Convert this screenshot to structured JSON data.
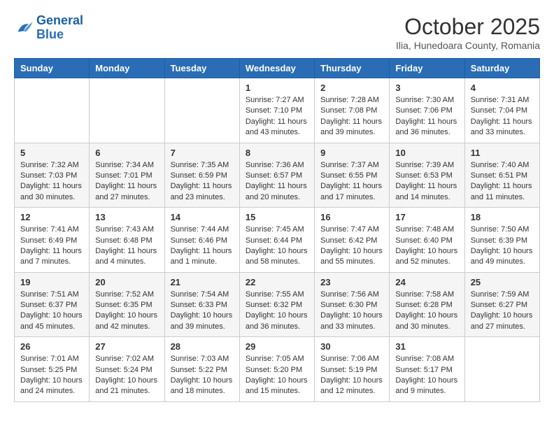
{
  "header": {
    "logo_general": "General",
    "logo_blue": "Blue",
    "month": "October 2025",
    "location": "Ilia, Hunedoara County, Romania"
  },
  "days_of_week": [
    "Sunday",
    "Monday",
    "Tuesday",
    "Wednesday",
    "Thursday",
    "Friday",
    "Saturday"
  ],
  "weeks": [
    [
      {
        "day": "",
        "sunrise": "",
        "sunset": "",
        "daylight": ""
      },
      {
        "day": "",
        "sunrise": "",
        "sunset": "",
        "daylight": ""
      },
      {
        "day": "",
        "sunrise": "",
        "sunset": "",
        "daylight": ""
      },
      {
        "day": "1",
        "sunrise": "Sunrise: 7:27 AM",
        "sunset": "Sunset: 7:10 PM",
        "daylight": "Daylight: 11 hours and 43 minutes."
      },
      {
        "day": "2",
        "sunrise": "Sunrise: 7:28 AM",
        "sunset": "Sunset: 7:08 PM",
        "daylight": "Daylight: 11 hours and 39 minutes."
      },
      {
        "day": "3",
        "sunrise": "Sunrise: 7:30 AM",
        "sunset": "Sunset: 7:06 PM",
        "daylight": "Daylight: 11 hours and 36 minutes."
      },
      {
        "day": "4",
        "sunrise": "Sunrise: 7:31 AM",
        "sunset": "Sunset: 7:04 PM",
        "daylight": "Daylight: 11 hours and 33 minutes."
      }
    ],
    [
      {
        "day": "5",
        "sunrise": "Sunrise: 7:32 AM",
        "sunset": "Sunset: 7:03 PM",
        "daylight": "Daylight: 11 hours and 30 minutes."
      },
      {
        "day": "6",
        "sunrise": "Sunrise: 7:34 AM",
        "sunset": "Sunset: 7:01 PM",
        "daylight": "Daylight: 11 hours and 27 minutes."
      },
      {
        "day": "7",
        "sunrise": "Sunrise: 7:35 AM",
        "sunset": "Sunset: 6:59 PM",
        "daylight": "Daylight: 11 hours and 23 minutes."
      },
      {
        "day": "8",
        "sunrise": "Sunrise: 7:36 AM",
        "sunset": "Sunset: 6:57 PM",
        "daylight": "Daylight: 11 hours and 20 minutes."
      },
      {
        "day": "9",
        "sunrise": "Sunrise: 7:37 AM",
        "sunset": "Sunset: 6:55 PM",
        "daylight": "Daylight: 11 hours and 17 minutes."
      },
      {
        "day": "10",
        "sunrise": "Sunrise: 7:39 AM",
        "sunset": "Sunset: 6:53 PM",
        "daylight": "Daylight: 11 hours and 14 minutes."
      },
      {
        "day": "11",
        "sunrise": "Sunrise: 7:40 AM",
        "sunset": "Sunset: 6:51 PM",
        "daylight": "Daylight: 11 hours and 11 minutes."
      }
    ],
    [
      {
        "day": "12",
        "sunrise": "Sunrise: 7:41 AM",
        "sunset": "Sunset: 6:49 PM",
        "daylight": "Daylight: 11 hours and 7 minutes."
      },
      {
        "day": "13",
        "sunrise": "Sunrise: 7:43 AM",
        "sunset": "Sunset: 6:48 PM",
        "daylight": "Daylight: 11 hours and 4 minutes."
      },
      {
        "day": "14",
        "sunrise": "Sunrise: 7:44 AM",
        "sunset": "Sunset: 6:46 PM",
        "daylight": "Daylight: 11 hours and 1 minute."
      },
      {
        "day": "15",
        "sunrise": "Sunrise: 7:45 AM",
        "sunset": "Sunset: 6:44 PM",
        "daylight": "Daylight: 10 hours and 58 minutes."
      },
      {
        "day": "16",
        "sunrise": "Sunrise: 7:47 AM",
        "sunset": "Sunset: 6:42 PM",
        "daylight": "Daylight: 10 hours and 55 minutes."
      },
      {
        "day": "17",
        "sunrise": "Sunrise: 7:48 AM",
        "sunset": "Sunset: 6:40 PM",
        "daylight": "Daylight: 10 hours and 52 minutes."
      },
      {
        "day": "18",
        "sunrise": "Sunrise: 7:50 AM",
        "sunset": "Sunset: 6:39 PM",
        "daylight": "Daylight: 10 hours and 49 minutes."
      }
    ],
    [
      {
        "day": "19",
        "sunrise": "Sunrise: 7:51 AM",
        "sunset": "Sunset: 6:37 PM",
        "daylight": "Daylight: 10 hours and 45 minutes."
      },
      {
        "day": "20",
        "sunrise": "Sunrise: 7:52 AM",
        "sunset": "Sunset: 6:35 PM",
        "daylight": "Daylight: 10 hours and 42 minutes."
      },
      {
        "day": "21",
        "sunrise": "Sunrise: 7:54 AM",
        "sunset": "Sunset: 6:33 PM",
        "daylight": "Daylight: 10 hours and 39 minutes."
      },
      {
        "day": "22",
        "sunrise": "Sunrise: 7:55 AM",
        "sunset": "Sunset: 6:32 PM",
        "daylight": "Daylight: 10 hours and 36 minutes."
      },
      {
        "day": "23",
        "sunrise": "Sunrise: 7:56 AM",
        "sunset": "Sunset: 6:30 PM",
        "daylight": "Daylight: 10 hours and 33 minutes."
      },
      {
        "day": "24",
        "sunrise": "Sunrise: 7:58 AM",
        "sunset": "Sunset: 6:28 PM",
        "daylight": "Daylight: 10 hours and 30 minutes."
      },
      {
        "day": "25",
        "sunrise": "Sunrise: 7:59 AM",
        "sunset": "Sunset: 6:27 PM",
        "daylight": "Daylight: 10 hours and 27 minutes."
      }
    ],
    [
      {
        "day": "26",
        "sunrise": "Sunrise: 7:01 AM",
        "sunset": "Sunset: 5:25 PM",
        "daylight": "Daylight: 10 hours and 24 minutes."
      },
      {
        "day": "27",
        "sunrise": "Sunrise: 7:02 AM",
        "sunset": "Sunset: 5:24 PM",
        "daylight": "Daylight: 10 hours and 21 minutes."
      },
      {
        "day": "28",
        "sunrise": "Sunrise: 7:03 AM",
        "sunset": "Sunset: 5:22 PM",
        "daylight": "Daylight: 10 hours and 18 minutes."
      },
      {
        "day": "29",
        "sunrise": "Sunrise: 7:05 AM",
        "sunset": "Sunset: 5:20 PM",
        "daylight": "Daylight: 10 hours and 15 minutes."
      },
      {
        "day": "30",
        "sunrise": "Sunrise: 7:06 AM",
        "sunset": "Sunset: 5:19 PM",
        "daylight": "Daylight: 10 hours and 12 minutes."
      },
      {
        "day": "31",
        "sunrise": "Sunrise: 7:08 AM",
        "sunset": "Sunset: 5:17 PM",
        "daylight": "Daylight: 10 hours and 9 minutes."
      },
      {
        "day": "",
        "sunrise": "",
        "sunset": "",
        "daylight": ""
      }
    ]
  ]
}
